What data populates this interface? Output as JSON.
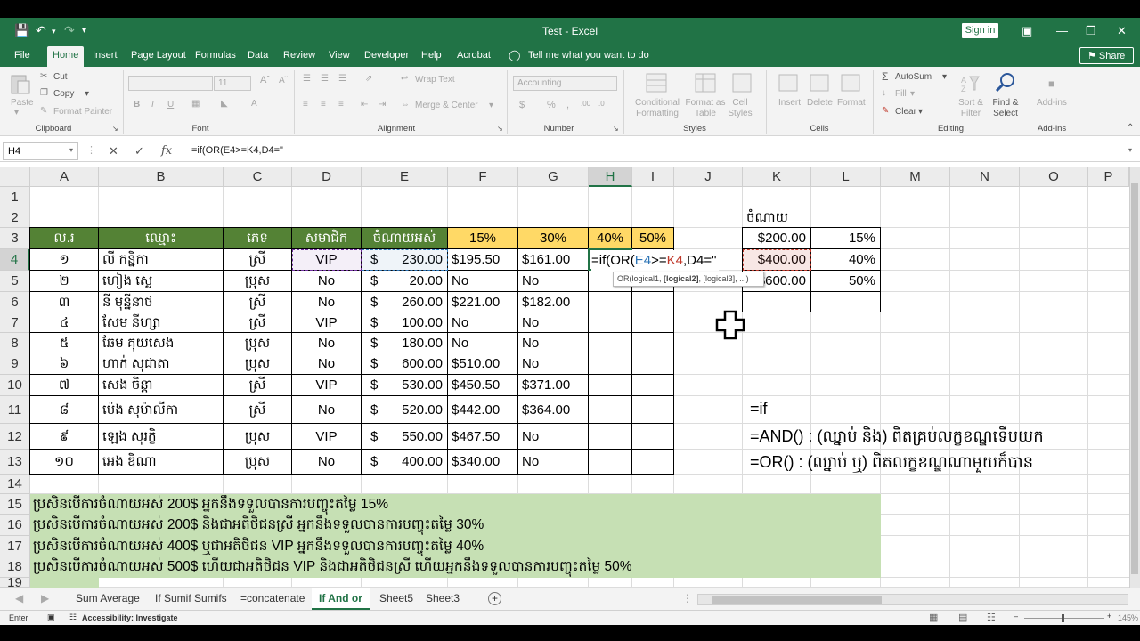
{
  "titlebar": {
    "title": "Test  -  Excel",
    "signin": "Sign in"
  },
  "tabs": [
    "File",
    "Home",
    "Insert",
    "Page Layout",
    "Formulas",
    "Data",
    "Review",
    "View",
    "Developer",
    "Help",
    "Acrobat"
  ],
  "tellme": "Tell me what you want to do",
  "share": "Share",
  "ribbon": {
    "clipboard": {
      "paste": "Paste",
      "cut": "Cut",
      "copy": "Copy",
      "format_painter": "Format Painter",
      "label": "Clipboard"
    },
    "font": {
      "size": "11",
      "label": "Font"
    },
    "alignment": {
      "wrap": "Wrap Text",
      "merge": "Merge & Center",
      "label": "Alignment"
    },
    "number": {
      "format": "Accounting",
      "label": "Number"
    },
    "styles": {
      "cond": "Conditional Formatting",
      "table": "Format as Table",
      "cell": "Cell Styles",
      "label": "Styles"
    },
    "cells": {
      "insert": "Insert",
      "delete": "Delete",
      "format": "Format",
      "label": "Cells"
    },
    "editing": {
      "autosum": "AutoSum",
      "fill": "Fill",
      "clear": "Clear",
      "sort": "Sort & Filter",
      "find": "Find & Select",
      "label": "Editing"
    },
    "addins": {
      "label": "Add-ins",
      "btn": "Add-ins"
    }
  },
  "formula_bar": {
    "name_box": "H4",
    "fx": "fx",
    "content": "=if(OR(E4>=K4,D4=\""
  },
  "columns": [
    "A",
    "B",
    "C",
    "D",
    "E",
    "F",
    "G",
    "H",
    "I",
    "J",
    "K",
    "L",
    "M",
    "N",
    "O",
    "P"
  ],
  "rows": [
    "1",
    "2",
    "3",
    "4",
    "5",
    "6",
    "7",
    "8",
    "9",
    "10",
    "11",
    "12",
    "13",
    "14",
    "15",
    "16",
    "17",
    "18",
    "19"
  ],
  "headers": {
    "a": "ល.រ",
    "b": "ឈ្មោះ",
    "c": "ភេទ",
    "d": "សមាជិក",
    "e": "ចំណាយអស់",
    "f": "15%",
    "g": "30%",
    "h": "40%",
    "i": "50%"
  },
  "table": [
    {
      "a": "១",
      "b": "លី កន្និកា",
      "c": "ស្រី",
      "d": "VIP",
      "e_sym": "$",
      "e": "230.00",
      "f": "$195.50",
      "g": "$161.00"
    },
    {
      "a": "២",
      "b": "ហៀង សេ្ង",
      "c": "ប្រុស",
      "d": "No",
      "e_sym": "$",
      "e": "20.00",
      "f": "No",
      "g": "No"
    },
    {
      "a": "៣",
      "b": "នី មុន្នីនាថ",
      "c": "ស្រី",
      "d": "No",
      "e_sym": "$",
      "e": "260.00",
      "f": "$221.00",
      "g": "$182.00"
    },
    {
      "a": "៤",
      "b": "សែម នីហ្សា",
      "c": "ស្រី",
      "d": "VIP",
      "e_sym": "$",
      "e": "100.00",
      "f": "No",
      "g": "No"
    },
    {
      "a": "៥",
      "b": "ឆែម គុយសេង",
      "c": "ប្រុស",
      "d": "No",
      "e_sym": "$",
      "e": "180.00",
      "f": "No",
      "g": "No"
    },
    {
      "a": "៦",
      "b": "ហាក់ សុជាតា",
      "c": "ប្រុស",
      "d": "No",
      "e_sym": "$",
      "e": "600.00",
      "f": "$510.00",
      "g": "No"
    },
    {
      "a": "៧",
      "b": "សេង ចិន្តា",
      "c": "ស្រី",
      "d": "VIP",
      "e_sym": "$",
      "e": "530.00",
      "f": "$450.50",
      "g": "$371.00"
    },
    {
      "a": "៨",
      "b": "ម៉េង សុម៉ាលីកា",
      "c": "ស្រី",
      "d": "No",
      "e_sym": "$",
      "e": "520.00",
      "f": "$442.00",
      "g": "$364.00"
    },
    {
      "a": "៩",
      "b": "ឡេង សុរក្ខិ",
      "c": "ប្រុស",
      "d": "VIP",
      "e_sym": "$",
      "e": "550.00",
      "f": "$467.50",
      "g": "No"
    },
    {
      "a": "១០",
      "b": "អេង ឌីណា",
      "c": "ប្រុស",
      "d": "No",
      "e_sym": "$",
      "e": "400.00",
      "f": "$340.00",
      "g": "No"
    }
  ],
  "editing_cell": {
    "p1": "=if(OR(",
    "p2": "E4",
    "p3": ">=",
    "p4": "K4",
    "p5": ",D4=\""
  },
  "tooltip": {
    "text": "OR(logical1, ",
    "bold": "[logical2]",
    "rest": ", [logical3], ...)"
  },
  "side": {
    "title": "ចំណាយ",
    "k": [
      "$200.00",
      "$400.00",
      "$600.00"
    ],
    "l": [
      "15%",
      "40%",
      "50%"
    ]
  },
  "notes": {
    "if": "=if",
    "and": "=AND() : (ឈ្នាប់ និង) ពិតគ្រប់លក្ខខណ្ឌទើបយក",
    "or": "=OR() : (ឈ្នាប់ ឬ) ពិតលក្ខខណ្ឌណាមួយក៏បាន"
  },
  "conditions": [
    "ប្រសិនបើការចំណាយអស់ 200$ អ្នកនឹងទទួលបានការបញ្ចុះតម្លៃ 15%",
    "ប្រសិនបើការចំណាយអស់ 200$ និងជាអតិថិជនស្រី អ្នកនឹងទទួលបានការបញ្ចុះតម្លៃ 30%",
    "ប្រសិនបើការចំណាយអស់ 400$ ឬជាអតិថិជន VIP អ្នកនឹងទទួលបានការបញ្ចុះតម្លៃ 40%",
    "ប្រសិនបើការចំណាយអស់ 500$ ហើយជាអតិថិជន VIP និងជាអតិថិជនស្រី ហើយអ្នកនឹងទទួលបានការបញ្ចុះតម្លៃ 50%"
  ],
  "sheets": [
    "Sum Average",
    "If Sumif Sumifs",
    "=concatenate",
    "If And  or",
    "Sheet5",
    "Sheet3"
  ],
  "status": {
    "mode": "Enter",
    "accessibility": "Accessibility: Investigate",
    "zoom": "145%"
  },
  "colors": {
    "excel_green": "#217346",
    "header_green": "#548235",
    "gold": "#ffd966",
    "light_green": "#c6e0b4"
  }
}
